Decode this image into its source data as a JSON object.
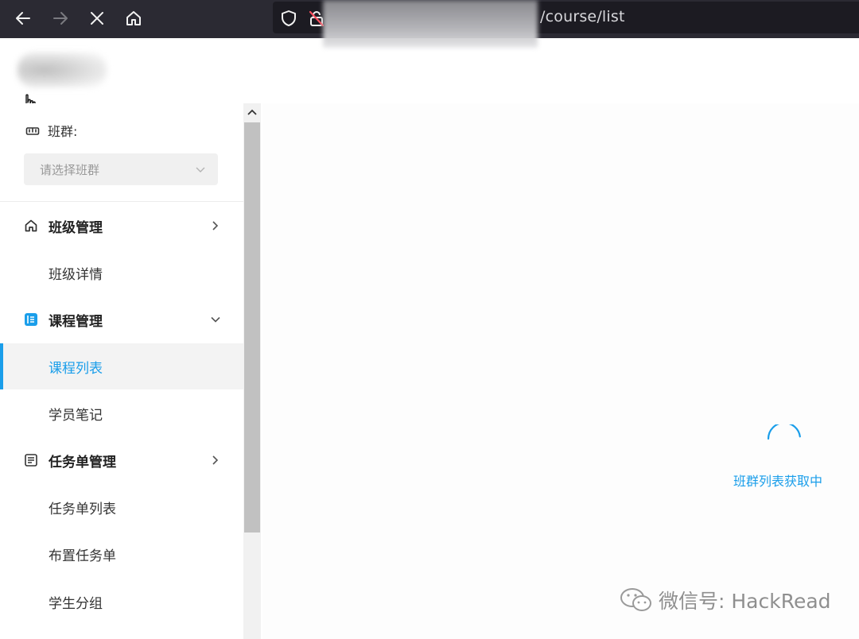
{
  "browser": {
    "url_visible_suffix": "/course/list"
  },
  "sidebar": {
    "class_group_label": "班群:",
    "class_select_placeholder": "请选择班群",
    "menu": [
      {
        "label": "班级管理",
        "type": "group",
        "icon": "home-icon",
        "expanded": false
      },
      {
        "label": "班级详情",
        "type": "subitem"
      },
      {
        "label": "课程管理",
        "type": "group",
        "icon": "course-book-icon",
        "expanded": true
      },
      {
        "label": "课程列表",
        "type": "subitem",
        "active": true
      },
      {
        "label": "学员笔记",
        "type": "subitem"
      },
      {
        "label": "任务单管理",
        "type": "group",
        "icon": "task-sheet-icon",
        "expanded": false
      },
      {
        "label": "任务单列表",
        "type": "subitem"
      },
      {
        "label": "布置任务单",
        "type": "subitem"
      },
      {
        "label": "学生分组",
        "type": "subitem"
      }
    ]
  },
  "main": {
    "loading_text": "班群列表获取中"
  },
  "watermark": {
    "text": "微信号: HackRead"
  },
  "colors": {
    "accent": "#1a9eea",
    "browser_bar": "#2b2a33",
    "url_box": "#1c1b22"
  }
}
